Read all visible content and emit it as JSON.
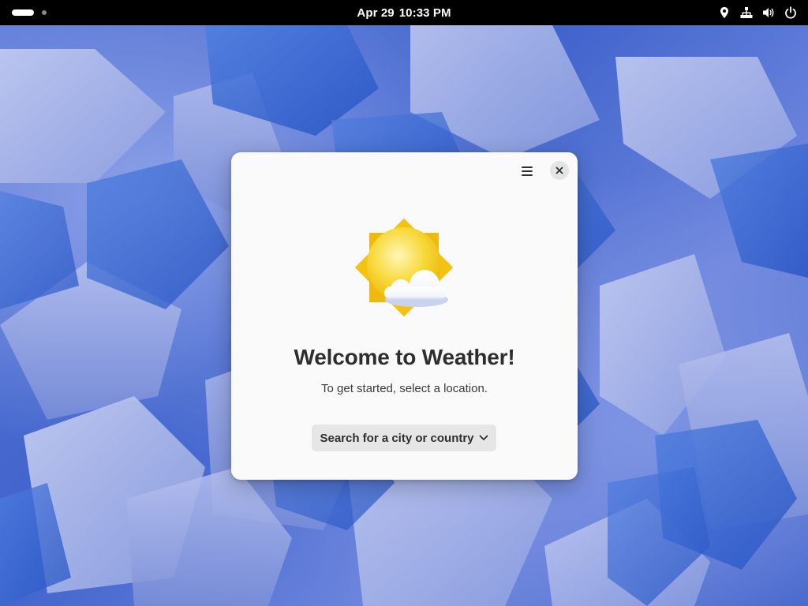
{
  "topbar": {
    "date": "Apr 29",
    "time": "10:33 PM",
    "icons": [
      "location-icon",
      "network-icon",
      "volume-icon",
      "power-icon"
    ]
  },
  "dialog": {
    "title": "Welcome to Weather!",
    "subtitle": "To get started, select a location.",
    "search_label": "Search for a city or country",
    "menu_icon": "hamburger-menu-icon",
    "close_icon": "close-icon",
    "illustration_icon": "sun-with-cloud-icon"
  },
  "colors": {
    "topbar_bg": "#000000",
    "dialog_bg": "#fafafa",
    "button_bg": "#e6e6e6",
    "sun_yellow": "#f5c211",
    "wallpaper_blue": "#4a67c8"
  }
}
